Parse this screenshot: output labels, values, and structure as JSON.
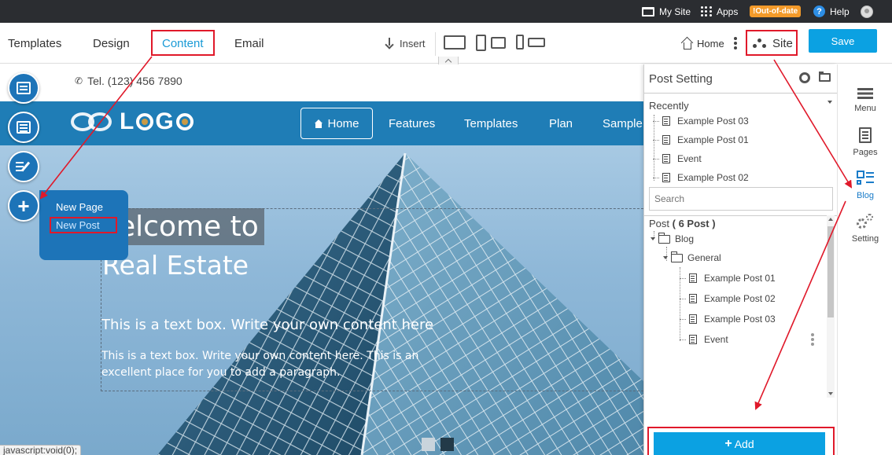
{
  "topbar": {
    "my_site": "My Site",
    "apps": "Apps",
    "badge": "!Out-of-date",
    "help": "Help"
  },
  "toolbar": {
    "tabs": [
      "Templates",
      "Design",
      "Content",
      "Email"
    ],
    "active_tab": "Content",
    "insert": "Insert",
    "home": "Home",
    "site": "Site",
    "save": "Save"
  },
  "preview": {
    "tel": "Tel. (123) 456 7890",
    "logo_text": "LOGO",
    "nav": [
      "Home",
      "Features",
      "Templates",
      "Plan",
      "Sample"
    ],
    "hero_title_line1": "elcome to",
    "hero_title_line2": "Real Estate",
    "hero_subtitle": "This is a text box. Write your own content here",
    "hero_paragraph": "This is a text box. Write your own content here. This is an excellent place for you to add a paragraph."
  },
  "new_menu": {
    "items": [
      "New Page",
      "New Post"
    ],
    "selected": "New Post"
  },
  "post_panel": {
    "title": "Post Setting",
    "recently_label": "Recently",
    "recent_items": [
      "Example Post 03",
      "Example Post 01",
      "Event",
      "Example Post 02"
    ],
    "search_placeholder": "Search",
    "post_label": "Post",
    "post_count": "( 6 Post )",
    "tree": {
      "root": "Blog",
      "category": "General",
      "posts": [
        "Example Post 01",
        "Example Post 02",
        "Example Post 03",
        "Event"
      ]
    },
    "add_button": "Add"
  },
  "right_sidebar": {
    "items": [
      "Menu",
      "Pages",
      "Blog",
      "Setting"
    ],
    "active": "Blog"
  },
  "status_text": "javascript:void(0);",
  "colors": {
    "accent": "#0ba1e2",
    "annotation_red": "#e0192a",
    "nav_blue": "#1f7db6",
    "fab_blue": "#1d74b8",
    "badge_orange": "#f39a2a"
  }
}
